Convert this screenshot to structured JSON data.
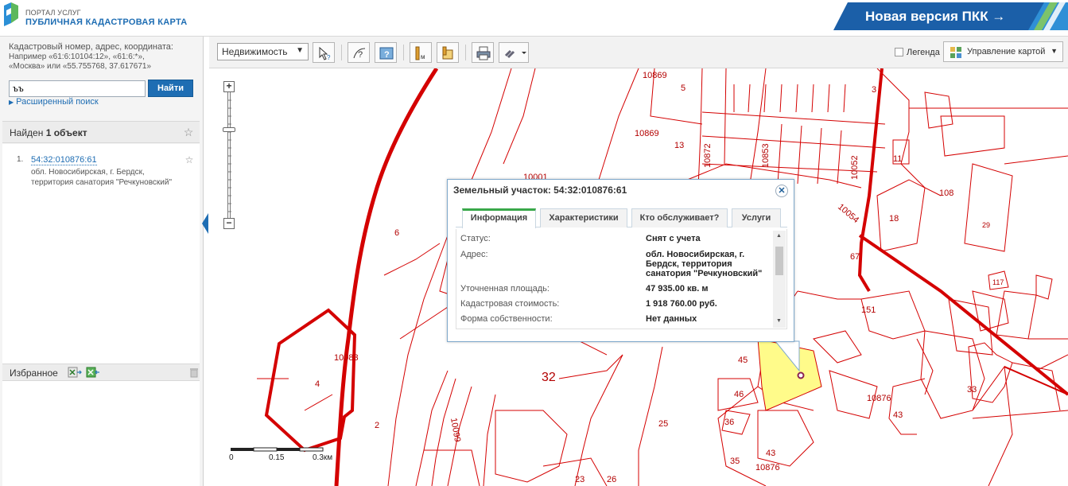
{
  "header": {
    "portal_small": "ПОРТАЛ УСЛУГ",
    "portal_title": "ПУБЛИЧНАЯ КАДАСТРОВАЯ КАРТА",
    "new_version": "Новая версия ПКК →",
    "accent_color": "#1e6db3"
  },
  "sidebar": {
    "hint_line1": "Кадастровый номер, адрес, координата:",
    "hint_line2": "Например «61:6:10104:12», «61:6:*»,",
    "hint_line3": "«Москва» или «55.755768, 37.617671»",
    "search_value": "ъъ",
    "search_button": "Найти",
    "advanced_search": "Расширенный поиск",
    "found_prefix": "Найден ",
    "found_count": "1 объект",
    "result": {
      "number": "1.",
      "cad_number": "54:32:010876:61",
      "address_line1": "обл. Новосибирская, г. Бердск,",
      "address_line2": "территория санатория \"Речкуновский\""
    },
    "favorites_label": "Избранное"
  },
  "toolbar": {
    "layer_select": "Недвижимость",
    "legend_label": "Легенда",
    "legend_checked": false,
    "map_manage": "Управление картой"
  },
  "map": {
    "labels": [
      "10869",
      "10869",
      "10001",
      "6",
      "10083",
      "4",
      "2",
      "32",
      "10876",
      "10876",
      "67",
      "151",
      "108",
      "18",
      "117",
      "29",
      "33",
      "43",
      "43",
      "45",
      "46",
      "36",
      "35",
      "25",
      "23",
      "26",
      "5",
      "13",
      "3",
      "11",
      "10872",
      "10853",
      "10054",
      "10052",
      "10099"
    ],
    "scale_0": "0",
    "scale_mid": "0.15",
    "scale_end": "0.3км",
    "parcel_color": "#d40000",
    "selected_fill": "#fffb8a"
  },
  "popup": {
    "title": "Земельный участок: 54:32:010876:61",
    "tabs": [
      "Информация",
      "Характеристики",
      "Кто обслуживает?",
      "Услуги"
    ],
    "active_tab": "Информация",
    "rows": [
      {
        "label": "Статус:",
        "value": "Снят с учета"
      },
      {
        "label": "Адрес:",
        "value": "обл. Новосибирская, г.",
        "value2": "Бердск, территория",
        "value3": "санатория \"Речкуновский\""
      },
      {
        "label": "Уточненная площадь:",
        "value": "47 935.00 кв. м"
      },
      {
        "label": "Кадастровая стоимость:",
        "value": "1 918 760.00 руб."
      },
      {
        "label": "Форма собственности:",
        "value": "Нет данных"
      }
    ]
  }
}
